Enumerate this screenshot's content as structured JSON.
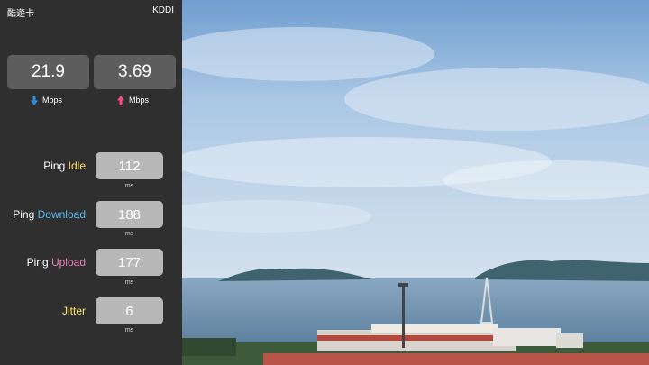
{
  "status_bar": {
    "carrier_left": "酷遊卡",
    "carrier_right": "KDDI"
  },
  "speeds": {
    "download": {
      "value": "21.9",
      "unit": "Mbps",
      "icon": "arrow-down-icon",
      "color": "#2f8de4"
    },
    "upload": {
      "value": "3.69",
      "unit": "Mbps",
      "icon": "arrow-up-icon",
      "color": "#f0508a"
    }
  },
  "metrics": [
    {
      "prefix": "Ping",
      "keyword": "Idle",
      "keyword_color": "#ffe36b",
      "value": "112",
      "unit": "ms"
    },
    {
      "prefix": "Ping",
      "keyword": "Download",
      "keyword_color": "#5bb8f0",
      "value": "188",
      "unit": "ms"
    },
    {
      "prefix": "Ping",
      "keyword": "Upload",
      "keyword_color": "#f07fb6",
      "value": "177",
      "unit": "ms"
    },
    {
      "prefix": "",
      "keyword": "Jitter",
      "keyword_color": "#ffe36b",
      "value": "6",
      "unit": "ms"
    }
  ]
}
